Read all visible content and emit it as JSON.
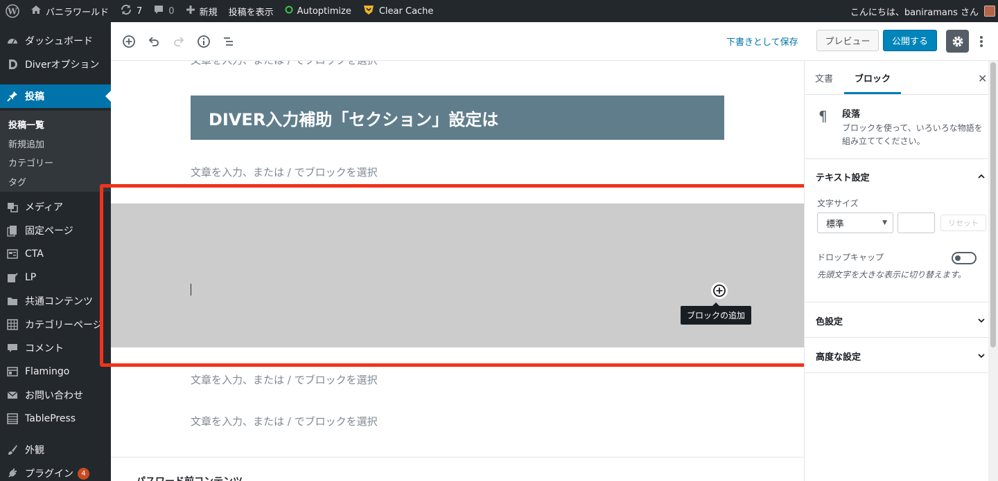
{
  "admin_bar": {
    "site_name": "バニラワールド",
    "updates_count": "7",
    "comments_count": "0",
    "new_label": "新規",
    "view_post_label": "投稿を表示",
    "autoptimize_label": "Autoptimize",
    "clear_cache_label": "Clear Cache",
    "greeting": "こんにちは、baniramans さん"
  },
  "sidebar": {
    "items": [
      {
        "label": "ダッシュボード",
        "icon": "dashboard-icon"
      },
      {
        "label": "Diverオプション",
        "icon": "diver-icon"
      },
      {
        "label": "投稿",
        "icon": "pin-icon",
        "active": true
      },
      {
        "label": "メディア",
        "icon": "media-icon"
      },
      {
        "label": "固定ページ",
        "icon": "page-icon"
      },
      {
        "label": "CTA",
        "icon": "cta-icon"
      },
      {
        "label": "LP",
        "icon": "lp-icon"
      },
      {
        "label": "共通コンテンツ",
        "icon": "folder-icon"
      },
      {
        "label": "カテゴリーページ",
        "icon": "grid-icon"
      },
      {
        "label": "コメント",
        "icon": "comment-icon"
      },
      {
        "label": "Flamingo",
        "icon": "flamingo-icon"
      },
      {
        "label": "お問い合わせ",
        "icon": "mail-icon"
      },
      {
        "label": "TablePress",
        "icon": "table-icon"
      },
      {
        "label": "外観",
        "icon": "brush-icon"
      },
      {
        "label": "プラグイン",
        "icon": "plugin-icon",
        "badge": "4"
      }
    ],
    "submenu": [
      "投稿一覧",
      "新規追加",
      "カテゴリー",
      "タグ"
    ]
  },
  "toolbar": {
    "save_draft_label": "下書きとして保存",
    "preview_label": "プレビュー",
    "publish_label": "公開する"
  },
  "editor": {
    "placeholder": "文章を入力、または / でブロックを選択",
    "heading": "DIVER入力補助「セクション」設定は",
    "tooltip": "ブロックの追加",
    "meta_title": "パスワード前コンテンツ"
  },
  "settings": {
    "tab_document": "文書",
    "tab_block": "ブロック",
    "block_name": "段落",
    "block_description": "ブロックを使って、いろいろな物語を組み立ててください。",
    "text_settings_title": "テキスト設定",
    "font_size_label": "文字サイズ",
    "font_size_value": "標準",
    "reset_label": "リセット",
    "drop_cap_label": "ドロップキャップ",
    "drop_cap_help": "先頭文字を大きな表示に切り替えます。",
    "color_settings_title": "色設定",
    "advanced_title": "高度な設定"
  },
  "colors": {
    "admin_dark": "#23282d",
    "wp_blue": "#0073aa",
    "heading_bg": "#607d8b",
    "highlight_red": "#f2331b"
  }
}
